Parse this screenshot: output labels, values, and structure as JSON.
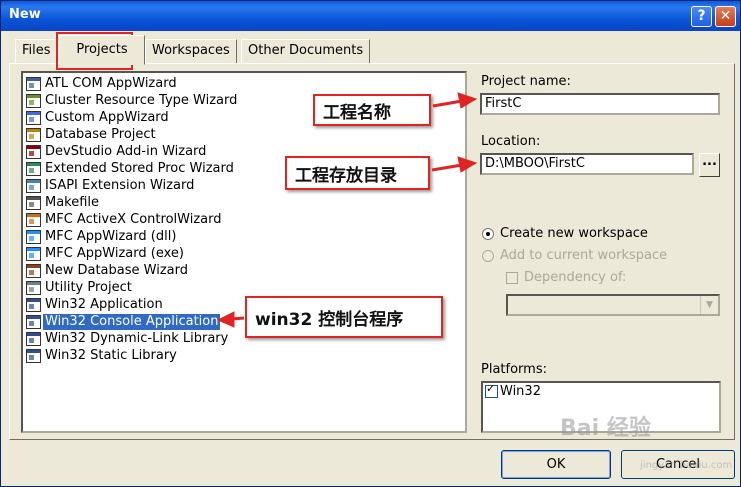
{
  "window": {
    "title": "New",
    "help_glyph": "?",
    "close_glyph": "✕"
  },
  "tabs": [
    {
      "label": "Files",
      "active": false
    },
    {
      "label": "Projects",
      "active": true
    },
    {
      "label": "Workspaces",
      "active": false
    },
    {
      "label": "Other Documents",
      "active": false
    }
  ],
  "projects": [
    {
      "label": "ATL COM AppWizard",
      "icon": "atl-wizard-icon"
    },
    {
      "label": "Cluster Resource Type Wizard",
      "icon": "cluster-wizard-icon"
    },
    {
      "label": "Custom AppWizard",
      "icon": "custom-appwizard-icon"
    },
    {
      "label": "Database Project",
      "icon": "database-project-icon"
    },
    {
      "label": "DevStudio Add-in Wizard",
      "icon": "addin-wizard-icon"
    },
    {
      "label": "Extended Stored Proc Wizard",
      "icon": "stored-proc-wizard-icon"
    },
    {
      "label": "ISAPI Extension Wizard",
      "icon": "isapi-wizard-icon"
    },
    {
      "label": "Makefile",
      "icon": "makefile-icon"
    },
    {
      "label": "MFC ActiveX ControlWizard",
      "icon": "mfc-activex-icon"
    },
    {
      "label": "MFC AppWizard (dll)",
      "icon": "mfc-dll-icon"
    },
    {
      "label": "MFC AppWizard (exe)",
      "icon": "mfc-exe-icon"
    },
    {
      "label": "New Database Wizard",
      "icon": "new-database-wizard-icon"
    },
    {
      "label": "Utility Project",
      "icon": "utility-project-icon"
    },
    {
      "label": "Win32 Application",
      "icon": "win32-application-icon"
    },
    {
      "label": "Win32 Console Application",
      "icon": "win32-console-icon",
      "selected": true
    },
    {
      "label": "Win32 Dynamic-Link Library",
      "icon": "win32-dll-icon"
    },
    {
      "label": "Win32 Static Library",
      "icon": "win32-static-library-icon"
    }
  ],
  "fields": {
    "project_name_label": "Project name:",
    "project_name_value": "FirstC",
    "location_label": "Location:",
    "location_value": "D:\\MBOO\\FirstC",
    "browse_label": "..."
  },
  "workspace": {
    "create_new": "Create new workspace",
    "add_to_current": "Add to current workspace",
    "dependency_of": "Dependency of:"
  },
  "platforms": {
    "label": "Platforms:",
    "items": [
      "Win32"
    ]
  },
  "buttons": {
    "ok": "OK",
    "cancel": "Cancel"
  },
  "annotations": {
    "project_name": "工程名称",
    "location": "工程存放目录",
    "console_app": "win32 控制台程序"
  },
  "colors": {
    "annotation_red": "#e02424",
    "selection_blue": "#316ac5",
    "title_blue": "#0a5ade"
  },
  "watermark": {
    "brand": "Bai 经验",
    "url": "jingyan.baidu.com"
  }
}
